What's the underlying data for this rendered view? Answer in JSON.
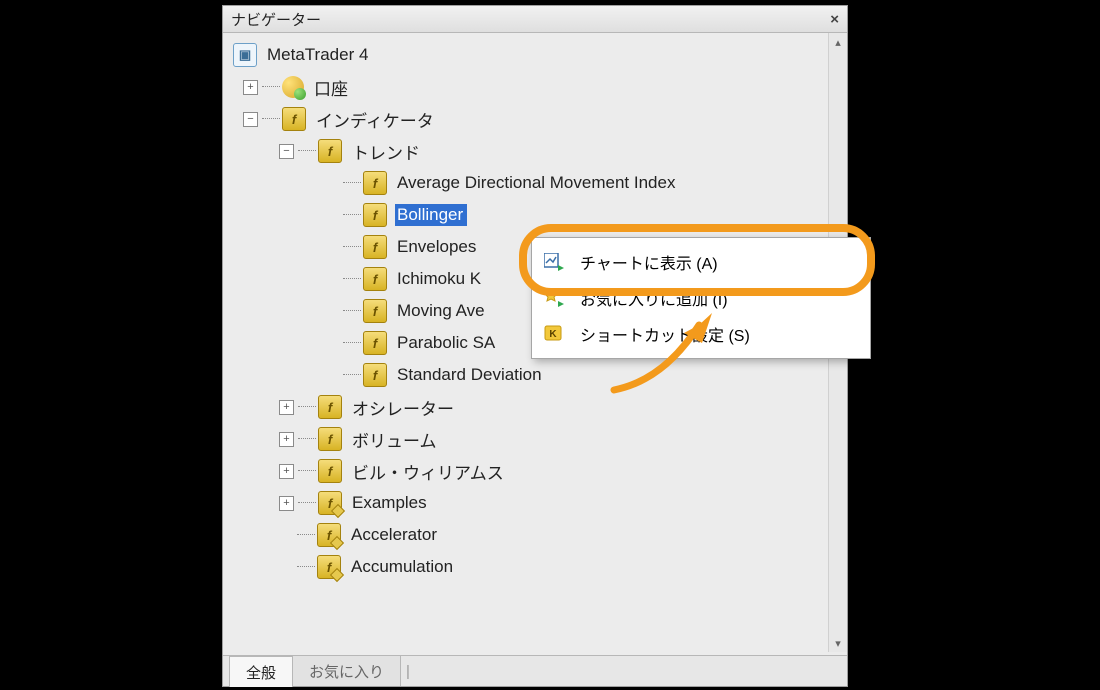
{
  "panel": {
    "title": "ナビゲーター"
  },
  "tree": {
    "root": "MetaTrader 4",
    "account": "口座",
    "indicators": "インディケータ",
    "trend": "トレンド",
    "trend_items": {
      "adx": "Average Directional Movement Index",
      "bollinger": "Bollinger Bands",
      "bollinger_visible": "Bollinger",
      "envelopes": "Envelopes",
      "ichimoku": "Ichimoku Kinko Hyo",
      "ichimoku_visible": "Ichimoku K",
      "ma": "Moving Average",
      "ma_visible": "Moving Ave",
      "psar": "Parabolic SAR",
      "psar_visible": "Parabolic SA",
      "stddev": "Standard Deviation"
    },
    "oscillator": "オシレーター",
    "volume": "ボリューム",
    "bill_williams": "ビル・ウィリアムス",
    "examples": "Examples",
    "accelerator": "Accelerator",
    "accumulation": "Accumulation"
  },
  "tabs": {
    "general": "全般",
    "favorites": "お気に入り"
  },
  "context_menu": {
    "attach": "チャートに表示 (A)",
    "favorite": "お気に入りに追加 (I)",
    "hotkey": "ショートカット設定 (S)"
  },
  "colors": {
    "accent": "#f39a1c",
    "select": "#2f6fd1"
  }
}
